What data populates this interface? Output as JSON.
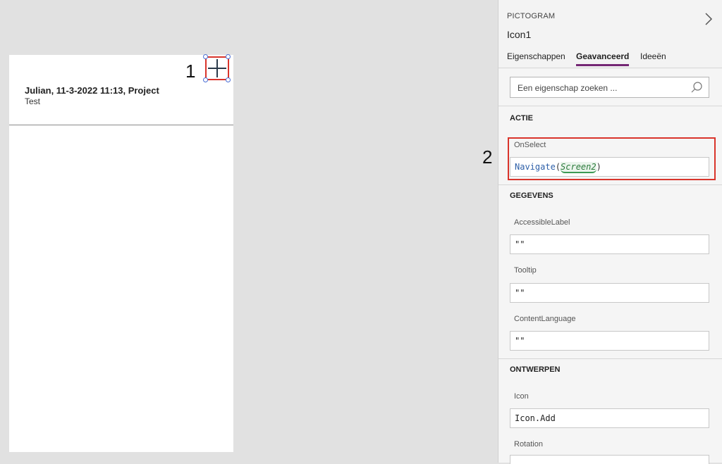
{
  "canvas": {
    "gallery_item": {
      "title": "Julian, 11-3-2022 11:13, Project",
      "subtitle": "Test"
    }
  },
  "annotations": {
    "marker_1": "1",
    "marker_2": "2"
  },
  "panel": {
    "control_type": "PICTOGRAM",
    "control_name": "Icon1",
    "tabs": [
      {
        "label": "Eigenschappen"
      },
      {
        "label": "Geavanceerd"
      },
      {
        "label": "Ideeën"
      }
    ],
    "active_tab": "Geavanceerd",
    "search": {
      "placeholder": "Een eigenschap zoeken ..."
    },
    "sections": {
      "actie": {
        "title": "ACTIE",
        "onselect": {
          "label": "OnSelect",
          "function": "Navigate",
          "open_paren": "(",
          "argument": "Screen2",
          "close_paren": ")"
        }
      },
      "gegevens": {
        "title": "GEGEVENS",
        "accessible_label": {
          "label": "AccessibleLabel",
          "value": "\"\""
        },
        "tooltip": {
          "label": "Tooltip",
          "value": "\"\""
        },
        "content_language": {
          "label": "ContentLanguage",
          "value": "\"\""
        }
      },
      "ontwerpen": {
        "title": "ONTWERPEN",
        "icon": {
          "label": "Icon",
          "value": "Icon.Add"
        },
        "rotation": {
          "label": "Rotation"
        }
      }
    }
  },
  "colors": {
    "highlight_red": "#d9342b",
    "tab_accent": "#742774",
    "function_blue": "#2d5fa8"
  },
  "icons": {
    "add": "add-icon",
    "chevron": "chevron-right-icon",
    "search": "search-icon"
  }
}
